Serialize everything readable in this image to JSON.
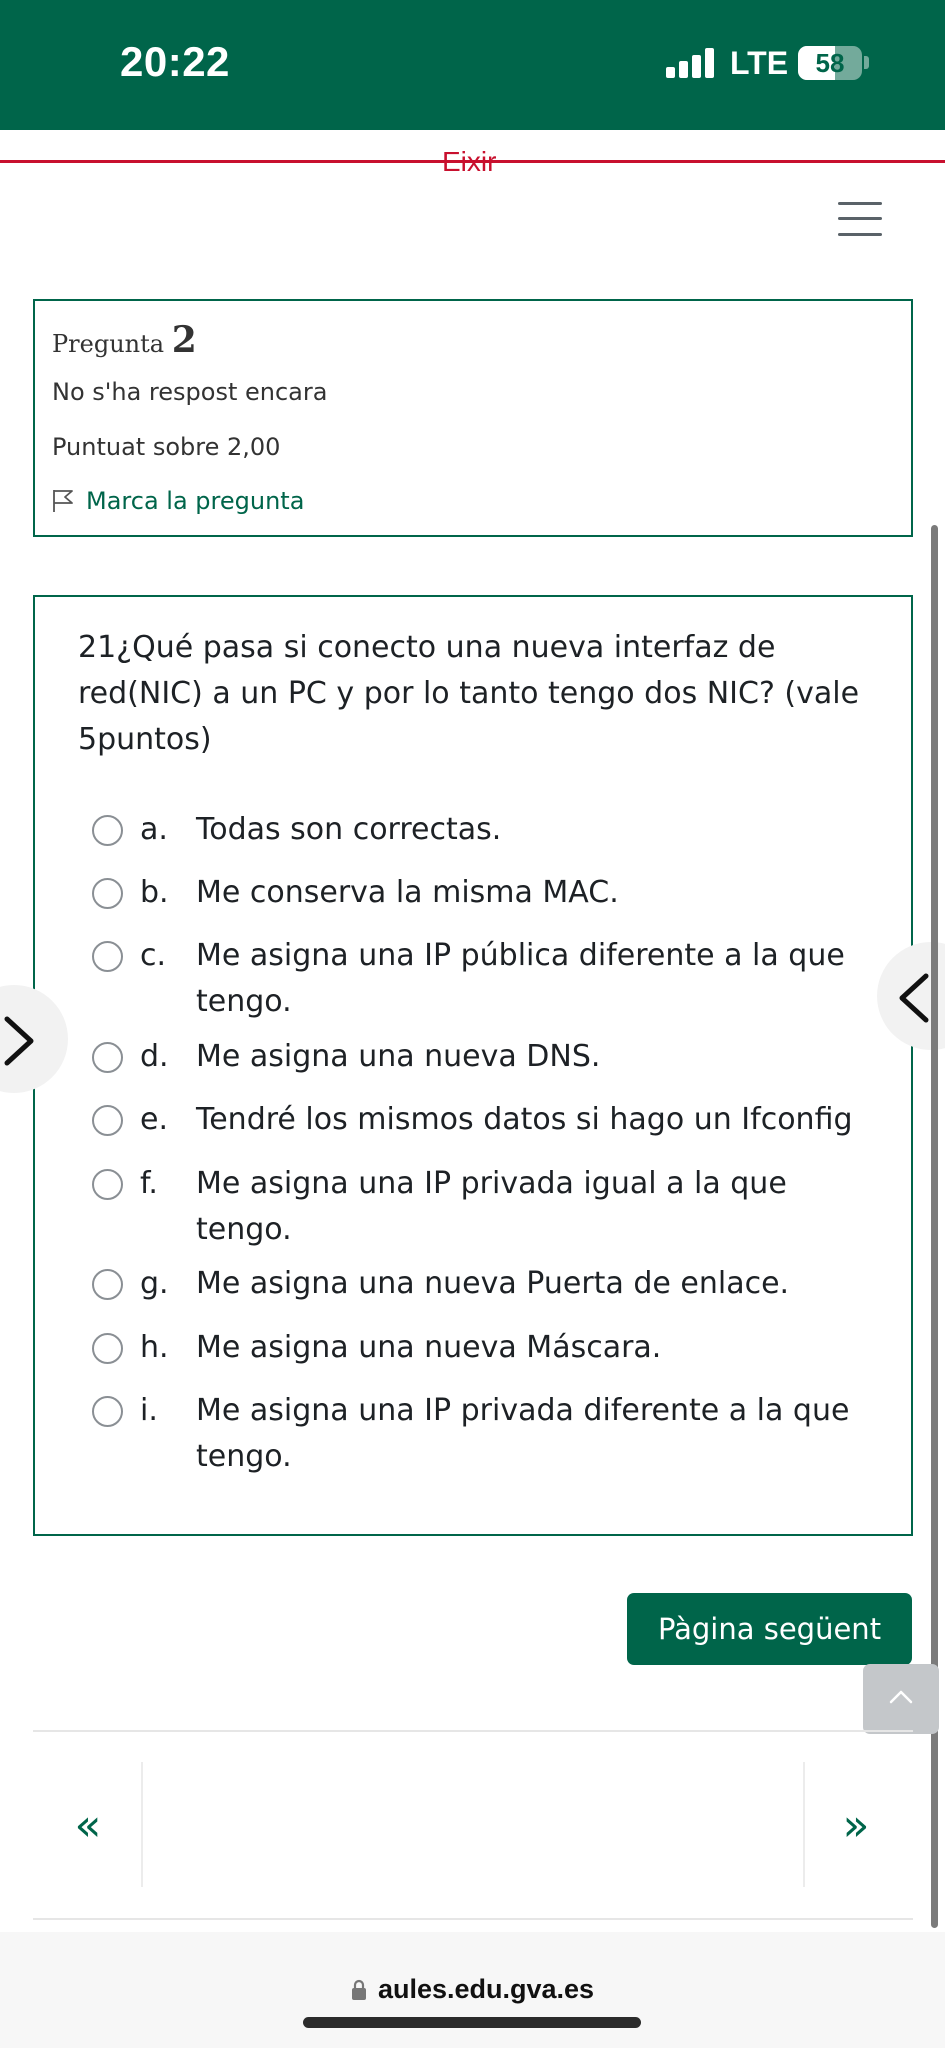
{
  "status_bar": {
    "time": "20:22",
    "network": "LTE",
    "battery": "58",
    "battery_level": 0.58,
    "background_color": "#00654a"
  },
  "header": {
    "exit_label": "Eixir",
    "menu_icon": "hamburger-icon"
  },
  "question_info": {
    "label": "Pregunta",
    "number": "2",
    "state": "No s'ha respost encara",
    "grade": "Puntuat sobre 2,00",
    "flag_label": "Marca la pregunta",
    "flag_icon": "flag-icon"
  },
  "question": {
    "text": "21¿Qué pasa si conecto una nueva interfaz de red(NIC) a un PC y por lo tanto tengo dos NIC? (vale 5puntos)",
    "answers": [
      {
        "letter": "a.",
        "text": "Todas son correctas."
      },
      {
        "letter": "b.",
        "text": "Me conserva la misma MAC."
      },
      {
        "letter": "c.",
        "text": "Me asigna una IP pública diferente a la que tengo."
      },
      {
        "letter": "d.",
        "text": "Me asigna una nueva DNS."
      },
      {
        "letter": "e.",
        "text": "Tendré los mismos datos si hago un Ifconfig"
      },
      {
        "letter": "f.",
        "text": "Me asigna una IP privada igual a la que tengo."
      },
      {
        "letter": "g.",
        "text": "Me asigna una nueva Puerta de enlace."
      },
      {
        "letter": "h.",
        "text": "Me asigna una nueva Máscara."
      },
      {
        "letter": "i.",
        "text": "Me asigna una IP privada diferente a la que tengo."
      }
    ]
  },
  "actions": {
    "next_page_label": "Pàgina següent"
  },
  "navigation": {
    "prev_label": "«",
    "next_label": "»"
  },
  "browser": {
    "url": "aules.edu.gva.es"
  },
  "colors": {
    "accent": "#00654a",
    "exit_red": "#c8102e"
  }
}
